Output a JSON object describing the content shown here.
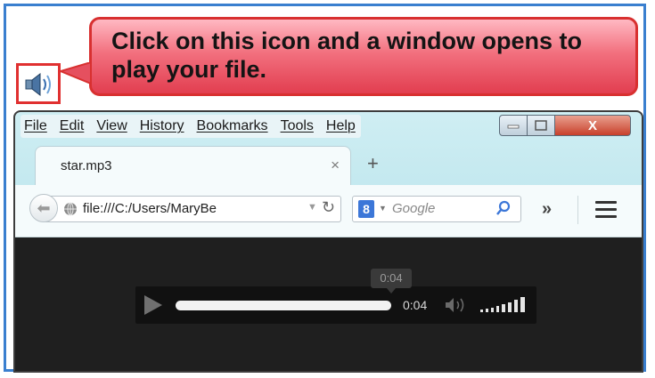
{
  "callout": {
    "text": "Click on this icon and a window opens to play your file."
  },
  "browser": {
    "menu": [
      "File",
      "Edit",
      "View",
      "History",
      "Bookmarks",
      "Tools",
      "Help"
    ],
    "window_controls": {
      "close_label": "X"
    },
    "tab": {
      "title": "star.mp3",
      "close_glyph": "×"
    },
    "new_tab_glyph": "+",
    "url": "file:///C:/Users/MaryBe",
    "search": {
      "engine_badge": "8",
      "placeholder": "Google"
    },
    "overflow_glyph": "»"
  },
  "player": {
    "tooltip": "0:04",
    "time": "0:04",
    "progress_fraction": 1.0
  },
  "colors": {
    "frame": "#3a7fcf",
    "callout_border": "#d83030",
    "player_bg": "#1f1f1f"
  }
}
